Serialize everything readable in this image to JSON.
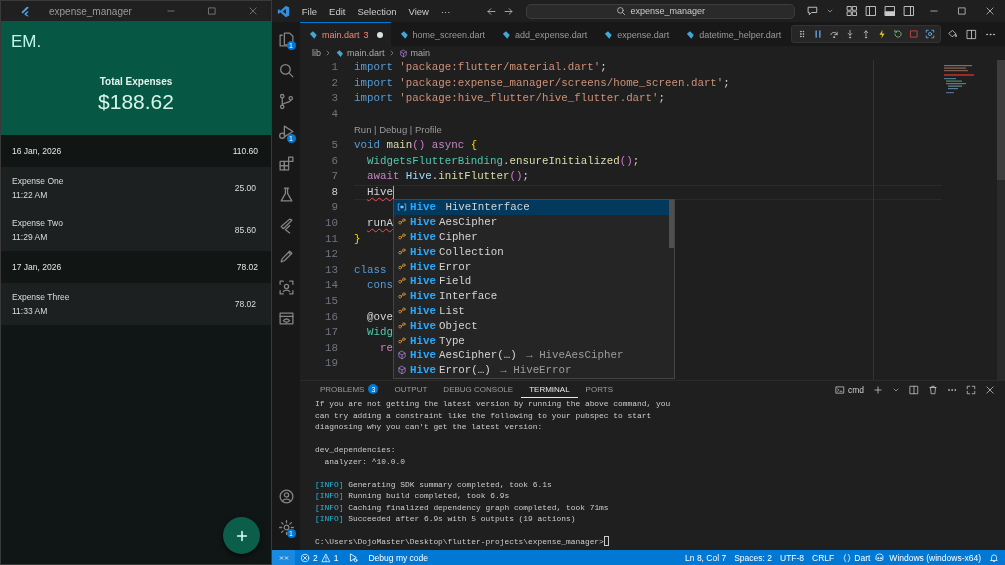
{
  "app_window": {
    "title": "expense_manager",
    "logo": "EM.",
    "total_label": "Total Expenses",
    "total": "$188.62",
    "groups": [
      {
        "date": "16 Jan, 2026",
        "total": "110.60",
        "expenses": [
          {
            "name": "Expense One",
            "time": "11:22 AM",
            "amount": "25.00"
          },
          {
            "name": "Expense Two",
            "time": "11:29 AM",
            "amount": "85.60"
          }
        ]
      },
      {
        "date": "17 Jan, 2026",
        "total": "78.02",
        "expenses": [
          {
            "name": "Expense Three",
            "time": "11:33 AM",
            "amount": "78.02"
          }
        ]
      }
    ]
  },
  "vscode": {
    "menu": [
      "File",
      "Edit",
      "Selection",
      "View",
      "···"
    ],
    "command_center": "expense_manager",
    "activity_bar": [
      {
        "kind": "files",
        "badge": "1"
      },
      {
        "kind": "search"
      },
      {
        "kind": "source-control"
      },
      {
        "kind": "run-debug",
        "badge": "1"
      },
      {
        "kind": "extensions"
      },
      {
        "kind": "testing"
      },
      {
        "kind": "flutter"
      },
      {
        "kind": "pencil"
      },
      {
        "kind": "scan"
      },
      {
        "kind": "preview"
      }
    ],
    "activity_bottom": [
      {
        "kind": "account"
      },
      {
        "kind": "settings",
        "badge": "1"
      }
    ],
    "tabs": [
      {
        "label": "main.dart",
        "problems": "3",
        "modified": true,
        "selected": true
      },
      {
        "label": "home_screen.dart",
        "modified": false,
        "selected": false
      },
      {
        "label": "add_expense.dart",
        "modified": false,
        "selected": false
      },
      {
        "label": "expense.dart",
        "modified": false,
        "selected": false
      },
      {
        "label": "datetime_helper.dart",
        "modified": false,
        "selected": false
      }
    ],
    "breadcrumb": [
      "lib",
      "main.dart",
      "main"
    ],
    "lines": [
      {
        "kind": "code",
        "number": "1",
        "current": false,
        "tokens": [
          {
            "text": "import ",
            "kind": "keyword"
          },
          {
            "text": "'package:flutter/material.dart'",
            "kind": "string"
          },
          {
            "text": ";",
            "kind": "plain"
          }
        ]
      },
      {
        "kind": "code",
        "number": "2",
        "current": false,
        "tokens": [
          {
            "text": "import ",
            "kind": "keyword"
          },
          {
            "text": "'package:expense_manager/screens/home_screen.dart'",
            "kind": "string"
          },
          {
            "text": ";",
            "kind": "plain"
          }
        ]
      },
      {
        "kind": "code",
        "number": "3",
        "current": false,
        "tokens": [
          {
            "text": "import ",
            "kind": "keyword"
          },
          {
            "text": "'package:hive_flutter/hive_flutter.dart'",
            "kind": "string"
          },
          {
            "text": ";",
            "kind": "plain"
          }
        ]
      },
      {
        "kind": "code",
        "number": "4",
        "current": false
      },
      {
        "kind": "codelens",
        "text": "Run | Debug | Profile"
      },
      {
        "kind": "code",
        "number": "5",
        "current": false,
        "tokens": [
          {
            "text": "void ",
            "kind": "keyword"
          },
          {
            "text": "main",
            "kind": "function"
          },
          {
            "text": "() ",
            "kind": "bracket"
          },
          {
            "text": "async ",
            "kind": "control"
          },
          {
            "text": "{",
            "kind": "brace"
          }
        ]
      },
      {
        "kind": "code",
        "number": "6",
        "current": false,
        "tokens": [
          {
            "text": "  WidgetsFlutterBinding",
            "kind": "type"
          },
          {
            "text": ".",
            "kind": "plain"
          },
          {
            "text": "ensureInitialized",
            "kind": "function"
          },
          {
            "text": "()",
            "kind": "bracket"
          },
          {
            "text": ";",
            "kind": "plain"
          }
        ]
      },
      {
        "kind": "code",
        "number": "7",
        "current": false,
        "tokens": [
          {
            "text": "  await ",
            "kind": "control"
          },
          {
            "text": "Hive",
            "kind": "variable"
          },
          {
            "text": ".",
            "kind": "plain"
          },
          {
            "text": "initFlutter",
            "kind": "function"
          },
          {
            "text": "()",
            "kind": "bracket"
          },
          {
            "text": ";",
            "kind": "plain"
          }
        ]
      },
      {
        "kind": "code",
        "number": "8",
        "current": true,
        "tokens": [
          {
            "text": "  Hive",
            "kind": "error"
          }
        ]
      },
      {
        "kind": "code",
        "number": "9",
        "current": false
      },
      {
        "kind": "code",
        "number": "10",
        "current": false,
        "tokens": [
          {
            "text": "  runA",
            "kind": "error"
          }
        ]
      },
      {
        "kind": "code",
        "number": "11",
        "current": false,
        "tokens": [
          {
            "text": "}",
            "kind": "brace"
          }
        ]
      },
      {
        "kind": "code",
        "number": "12",
        "current": false
      },
      {
        "kind": "code",
        "number": "13",
        "current": false,
        "tokens": [
          {
            "text": "class",
            "kind": "keyword"
          }
        ]
      },
      {
        "kind": "code",
        "number": "14",
        "current": false,
        "tokens": [
          {
            "text": "  cons",
            "kind": "keyword"
          }
        ]
      },
      {
        "kind": "code",
        "number": "15",
        "current": false
      },
      {
        "kind": "code",
        "number": "16",
        "current": false,
        "tokens": [
          {
            "text": "  @ove",
            "kind": "plain"
          }
        ]
      },
      {
        "kind": "code",
        "number": "17",
        "current": false,
        "tokens": [
          {
            "text": "  Widg",
            "kind": "type"
          }
        ]
      },
      {
        "kind": "code",
        "number": "18",
        "current": false,
        "tokens": [
          {
            "text": "    re",
            "kind": "control"
          }
        ]
      },
      {
        "kind": "code",
        "number": "19",
        "current": false
      }
    ],
    "suggestions": [
      {
        "kind": "variable",
        "match": "Hive",
        "detail": "HiveInterface",
        "selected": true
      },
      {
        "kind": "class",
        "match": "Hive",
        "label": "AesCipher",
        "selected": false
      },
      {
        "kind": "class",
        "match": "Hive",
        "label": "Cipher",
        "selected": false
      },
      {
        "kind": "class",
        "match": "Hive",
        "label": "Collection",
        "selected": false
      },
      {
        "kind": "class",
        "match": "Hive",
        "label": "Error",
        "selected": false
      },
      {
        "kind": "class",
        "match": "Hive",
        "label": "Field",
        "selected": false
      },
      {
        "kind": "class",
        "match": "Hive",
        "label": "Interface",
        "selected": false
      },
      {
        "kind": "class",
        "match": "Hive",
        "label": "List",
        "selected": false
      },
      {
        "kind": "class",
        "match": "Hive",
        "label": "Object",
        "selected": false
      },
      {
        "kind": "class",
        "match": "Hive",
        "label": "Type",
        "selected": false
      },
      {
        "kind": "constructor",
        "match": "Hive",
        "label": "AesCipher(…)",
        "detail": "→ HiveAesCipher",
        "selected": false
      },
      {
        "kind": "constructor",
        "match": "Hive",
        "label": "Error(…)",
        "detail": "→ HiveError",
        "selected": false
      }
    ],
    "panel_tabs": [
      {
        "label": "PROBLEMS",
        "badge": "3",
        "selected": false
      },
      {
        "label": "OUTPUT",
        "selected": false
      },
      {
        "label": "DEBUG CONSOLE",
        "selected": false
      },
      {
        "label": "TERMINAL",
        "selected": true
      },
      {
        "label": "PORTS",
        "selected": false
      }
    ],
    "terminal_profile": "cmd",
    "terminal": [
      [
        {
          "kind": "text",
          "text": "If you are not getting the latest version by running the above command, you"
        },
        {
          "kind": "text",
          "text": "can try adding a constraint like the following to your pubspec to start"
        },
        {
          "kind": "text",
          "text": "diagnosing why you can't get the latest version:"
        }
      ],
      [
        {
          "kind": "text",
          "text": "dev_dependencies:"
        },
        {
          "kind": "text",
          "text": "  analyzer: ^10.0.0"
        }
      ],
      [
        {
          "kind": "info",
          "tag": "[INFO]",
          "text": "Generating SDK summary completed, took 6.1s"
        },
        {
          "kind": "info",
          "tag": "[INFO]",
          "text": "Running build completed, took 6.9s"
        },
        {
          "kind": "info",
          "tag": "[INFO]",
          "text": "Caching finalized dependency graph completed, took 71ms"
        },
        {
          "kind": "info",
          "tag": "[INFO]",
          "text": "Succeeded after 6.9s with 5 outputs (19 actions)"
        }
      ],
      [
        {
          "kind": "prompt",
          "text": "C:\\Users\\DojoMaster\\Desktop\\flutter-projects\\expense_manager>"
        }
      ]
    ],
    "status_bar": {
      "errors": "2",
      "warnings": "1",
      "debug_label": "Debug my code",
      "right": [
        {
          "kind": "text",
          "text": "Ln 8, Col 7"
        },
        {
          "kind": "text",
          "text": "Spaces: 2"
        },
        {
          "kind": "text",
          "text": "UTF-8"
        },
        {
          "kind": "text",
          "text": "CRLF"
        },
        {
          "kind": "language",
          "text": "Dart"
        },
        {
          "kind": "platform",
          "text": "Windows (windows-x64)"
        }
      ]
    }
  }
}
